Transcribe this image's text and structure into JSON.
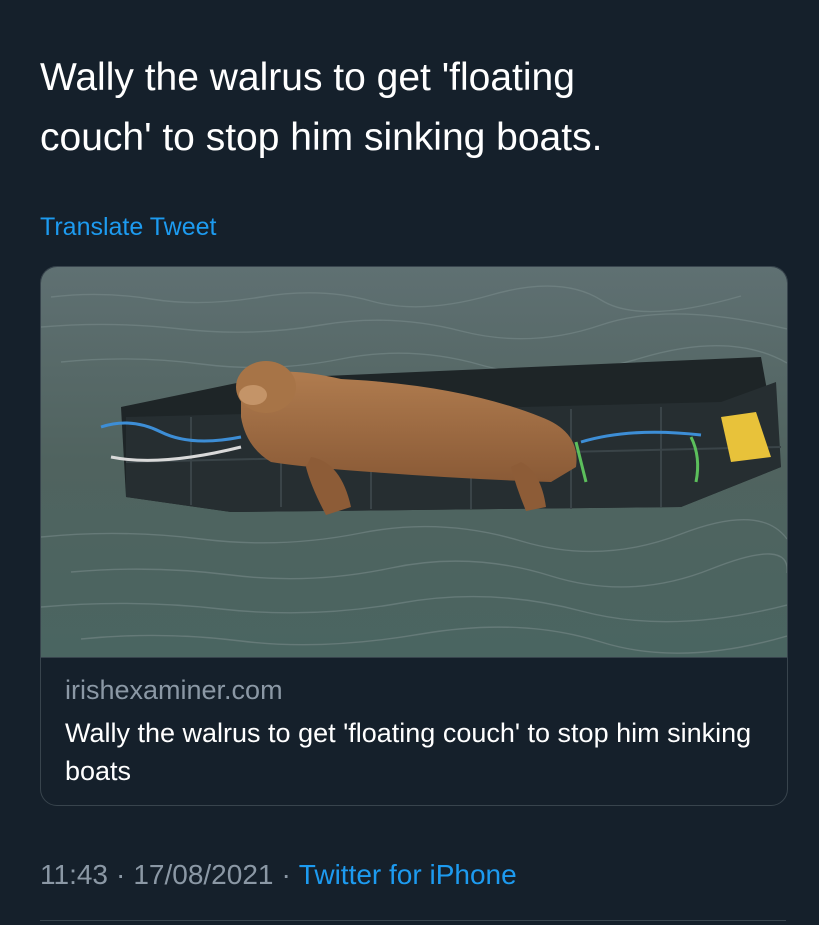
{
  "tweet": {
    "text": "Wally the walrus to get 'floating\ncouch' to stop him sinking boats.",
    "translate_label": "Translate Tweet"
  },
  "card": {
    "image": "walrus-on-floating-pontoon-photo",
    "domain": "irishexaminer.com",
    "title": "Wally the walrus to get 'floating couch' to stop him sinking boats"
  },
  "meta": {
    "time": "11:43",
    "separator": "·",
    "date": "17/08/2021",
    "source": "Twitter for iPhone"
  },
  "colors": {
    "background": "#15202b",
    "accent": "#1d9bf0",
    "secondary_text": "#8b98a5",
    "border": "#38444d"
  }
}
